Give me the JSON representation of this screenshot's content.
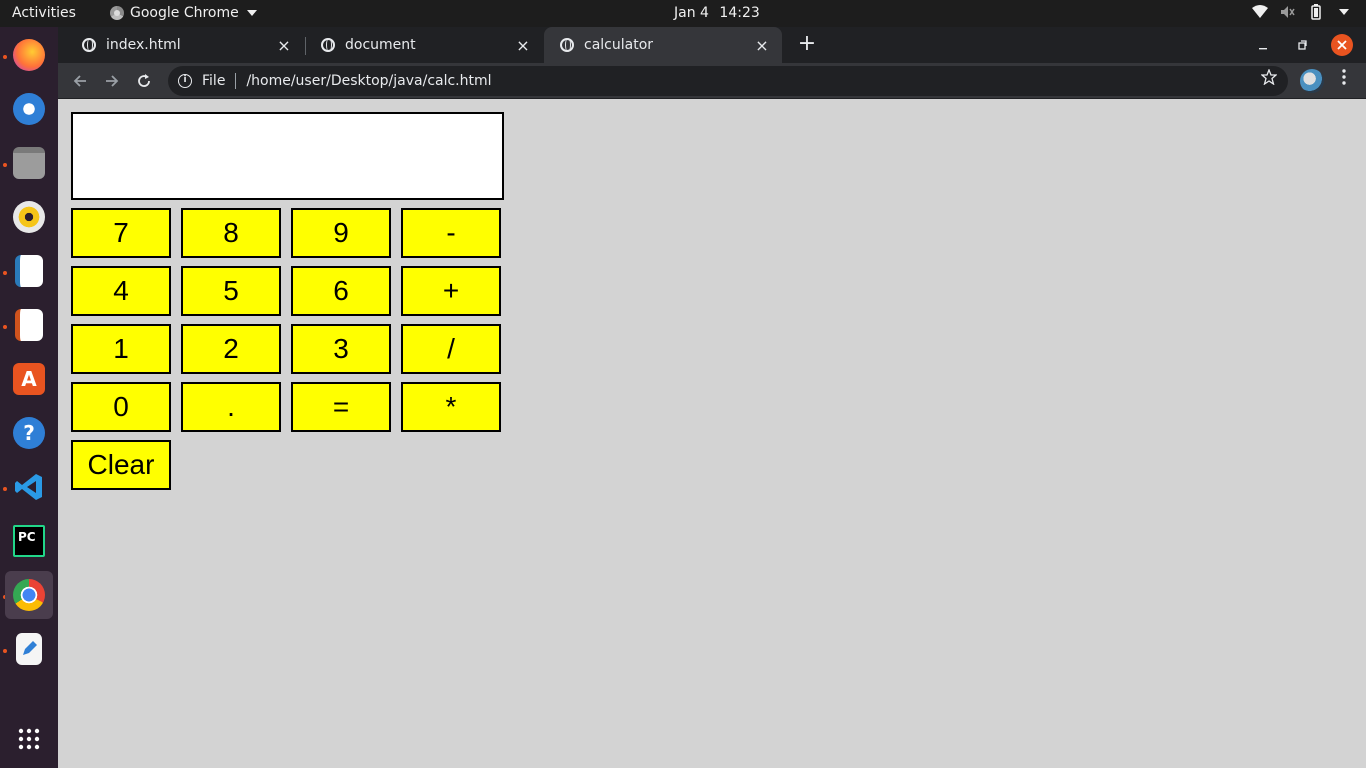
{
  "topbar": {
    "activities": "Activities",
    "app_name": "Google Chrome",
    "date": "Jan 4",
    "time": "14:23",
    "tray_icons": [
      "wifi-icon",
      "volume-icon",
      "battery-icon",
      "system-menu-icon"
    ]
  },
  "dock": {
    "apps": [
      {
        "name": "firefox",
        "running": true
      },
      {
        "name": "thunderbird",
        "running": false
      },
      {
        "name": "files",
        "running": true
      },
      {
        "name": "rhythmbox",
        "running": false
      },
      {
        "name": "libreoffice-writer",
        "running": true
      },
      {
        "name": "libreoffice-impress",
        "running": true
      },
      {
        "name": "ubuntu-software",
        "running": false
      },
      {
        "name": "help",
        "running": false
      },
      {
        "name": "vscode",
        "running": true
      },
      {
        "name": "pycharm",
        "running": false,
        "label": "PC"
      },
      {
        "name": "chrome",
        "running": true,
        "active": true
      },
      {
        "name": "text-editor",
        "running": true
      },
      {
        "name": "show-applications",
        "running": false
      }
    ]
  },
  "browser": {
    "tabs": [
      {
        "title": "index.html",
        "active": false
      },
      {
        "title": "document",
        "active": false
      },
      {
        "title": "calculator",
        "active": true
      }
    ],
    "close_glyph": "×",
    "new_tab_glyph": "+",
    "url_scheme_label": "File",
    "url": "/home/user/Desktop/java/calc.html"
  },
  "calculator": {
    "display_value": "",
    "keys": [
      [
        "7",
        "8",
        "9",
        "-"
      ],
      [
        "4",
        "5",
        "6",
        "+"
      ],
      [
        "1",
        "2",
        "3",
        "/"
      ],
      [
        "0",
        ".",
        "=",
        "*"
      ]
    ],
    "clear_label": "Clear"
  },
  "colors": {
    "page_bg": "#d3d3d3",
    "key_bg": "#ffff00",
    "accent": "#e95420"
  }
}
